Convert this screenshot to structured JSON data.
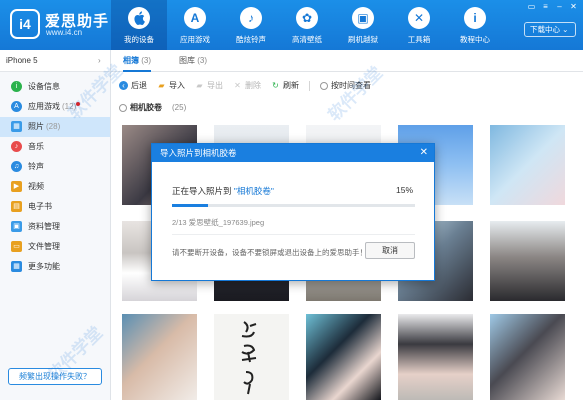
{
  "app": {
    "logo_badge": "i4",
    "name": "爱思助手",
    "url": "www.i4.cn",
    "download_label": "下载中心"
  },
  "nav": [
    {
      "label": "我的设备",
      "icon": "apple-icon",
      "glyph": "",
      "active": true
    },
    {
      "label": "应用游戏",
      "icon": "app-store-icon",
      "glyph": "A",
      "active": false
    },
    {
      "label": "酷炫铃声",
      "icon": "bell-icon",
      "glyph": "♪",
      "active": false
    },
    {
      "label": "高清壁纸",
      "icon": "flower-icon",
      "glyph": "✿",
      "active": false
    },
    {
      "label": "刷机越狱",
      "icon": "box-icon",
      "glyph": "▣",
      "active": false
    },
    {
      "label": "工具箱",
      "icon": "tools-icon",
      "glyph": "✕",
      "active": false
    },
    {
      "label": "教程中心",
      "icon": "info-icon",
      "glyph": "i",
      "active": false
    }
  ],
  "sidebar": {
    "device_name": "iPhone 5",
    "items": [
      {
        "label": "设备信息",
        "count": "",
        "icon": "info-icon",
        "color": "#2bb24c",
        "glyph": "i"
      },
      {
        "label": "应用游戏",
        "count": "(12)",
        "icon": "apps-icon",
        "color": "#2a8be0",
        "glyph": "A",
        "dot": true
      },
      {
        "label": "照片",
        "count": "(28)",
        "icon": "photo-icon",
        "color": "#3a9be8",
        "glyph": "▦",
        "active": true
      },
      {
        "label": "音乐",
        "count": "",
        "icon": "music-icon",
        "color": "#e84c4c",
        "glyph": "♪"
      },
      {
        "label": "铃声",
        "count": "",
        "icon": "bell-icon",
        "color": "#2a8be0",
        "glyph": "♫"
      },
      {
        "label": "视频",
        "count": "",
        "icon": "video-icon",
        "color": "#e8a020",
        "glyph": "▶"
      },
      {
        "label": "电子书",
        "count": "",
        "icon": "book-icon",
        "color": "#e8a020",
        "glyph": "▤"
      },
      {
        "label": "资料管理",
        "count": "",
        "icon": "contacts-icon",
        "color": "#3a9be8",
        "glyph": "▣"
      },
      {
        "label": "文件管理",
        "count": "",
        "icon": "folder-icon",
        "color": "#e8a020",
        "glyph": "▭"
      },
      {
        "label": "更多功能",
        "count": "",
        "icon": "more-icon",
        "color": "#2a8be0",
        "glyph": "▦"
      }
    ],
    "feedback_label": "频繁出现操作失败？"
  },
  "tabs": [
    {
      "label": "相簿",
      "count": "(3)",
      "active": true
    },
    {
      "label": "图库",
      "count": "(3)",
      "active": false
    }
  ],
  "toolbar": {
    "back": "后退",
    "import": "导入",
    "export": "导出",
    "delete": "删除",
    "refresh": "刷新",
    "view_by_time": "按时间查看"
  },
  "album": {
    "name": "相机胶卷",
    "count": "(25)"
  },
  "modal": {
    "title": "导入照片到相机胶卷",
    "status_prefix": "正在导入照片到",
    "album_quoted": "\"相机胶卷\"",
    "percent_label": "15%",
    "progress": 0.15,
    "file_label": "2/13 爱思壁纸_197639.jpeg",
    "hint": "请不要断开设备，设备不要锁屏或退出设备上的爱思助手！",
    "cancel_label": "取消",
    "close_glyph": "✕"
  },
  "watermark": "软件学堂"
}
